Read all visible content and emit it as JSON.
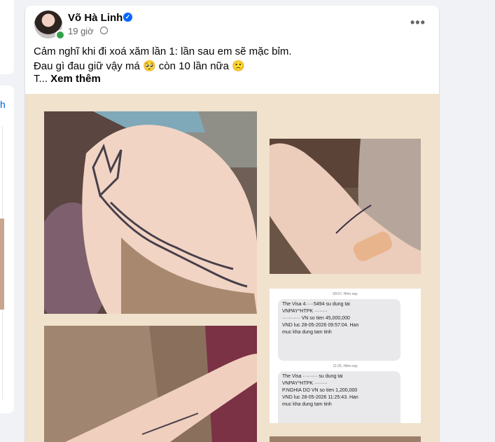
{
  "post": {
    "author": "Võ Hà Linh",
    "time": "19 giờ",
    "line1": "Cảm nghĩ khi đi xoá xăm lần 1: lần sau em sẽ mặc bỉm.",
    "line2": "Đau gì đau giữ vậy má 🥺 còn 10 lần nữa 🙁",
    "line3_prefix": "T... ",
    "see_more": "Xem thêm"
  },
  "sms": {
    "time1": "09:57, Hôm nay",
    "msg1": [
      "The Visa 4·····5494 su dung tai",
      "VNPAY*HTPK ········",
      "··········· VN so tien 45,000,000",
      "VND luc 28-05-2026 09:57:04. Han",
      "muc kha dung tam tinh"
    ],
    "time2": "11:25, Hôm nay",
    "msg2": [
      "The Visa ········· su dung tai",
      "VNPAY*HTPK ········",
      "P.NGHIA DO VN so tien 1,200,000",
      "VND luc 28-05-2026 11:25:43. Han",
      "muc kha dung tam tinh"
    ]
  },
  "left_panel": {
    "link_letter": "h"
  },
  "colors": {
    "accent": "#0866ff",
    "online": "#31a24c",
    "media_bg": "#f0e2cd"
  },
  "icons": [
    "verified-badge-icon",
    "globe-icon",
    "more-options-icon"
  ]
}
